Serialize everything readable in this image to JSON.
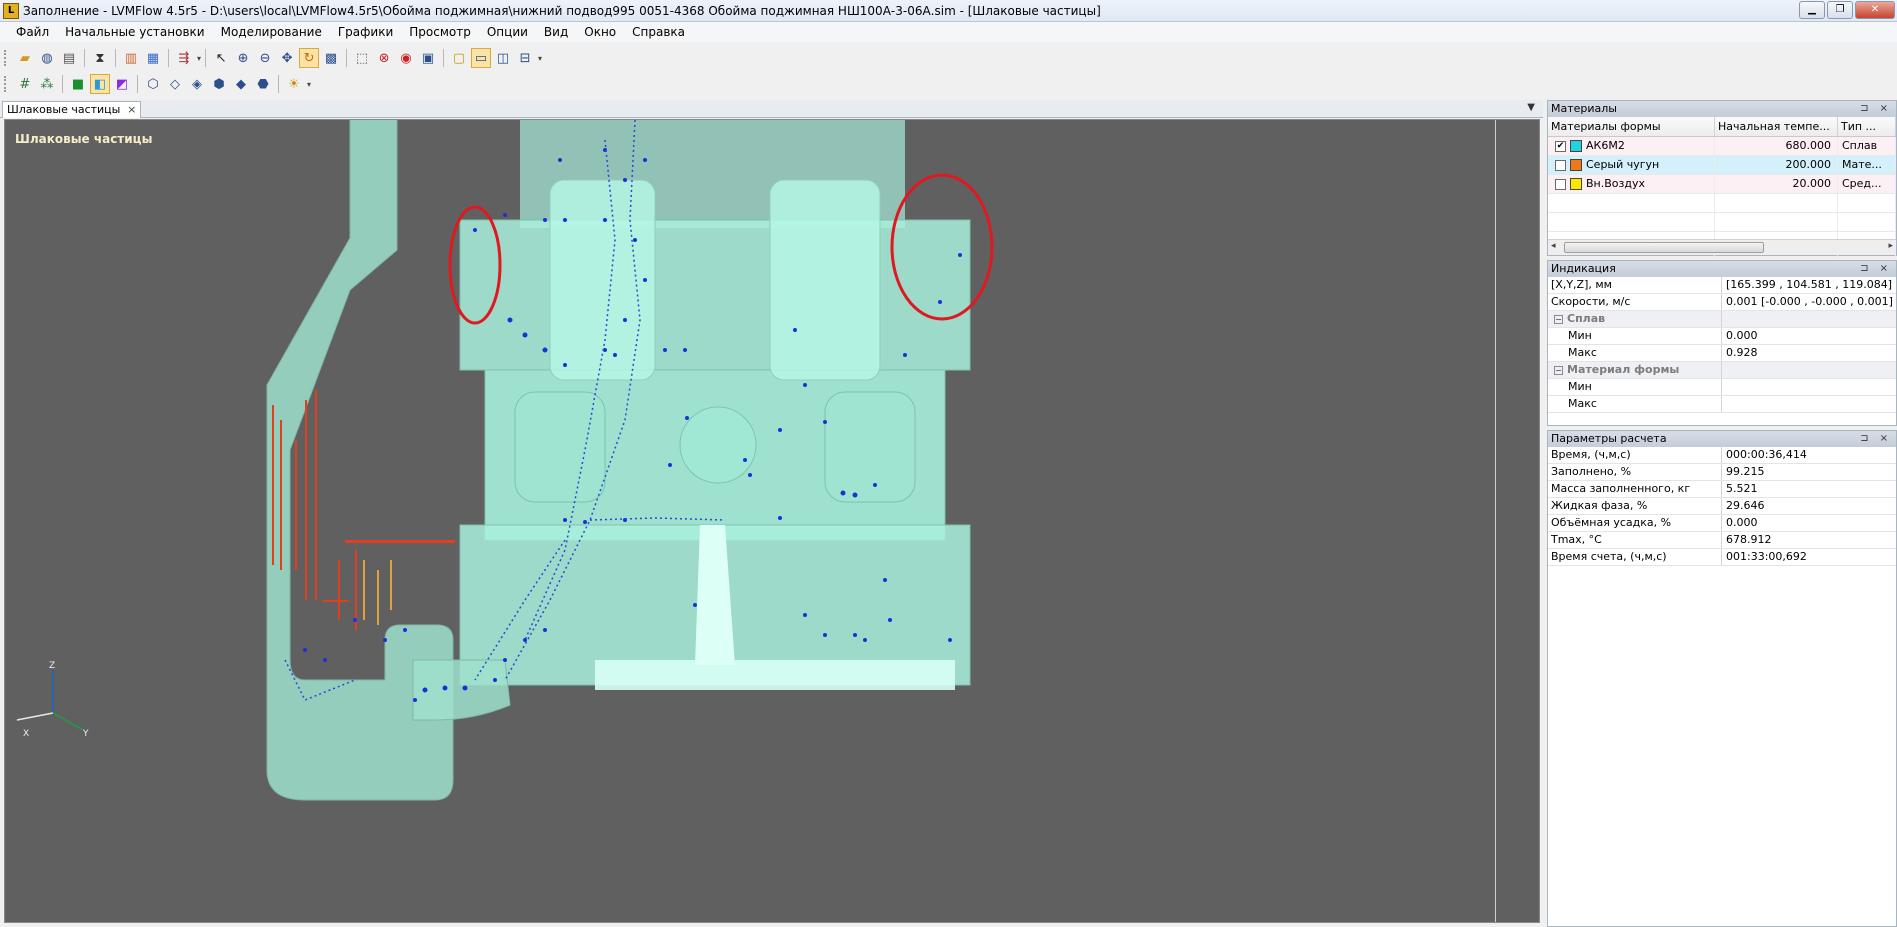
{
  "window": {
    "app_icon": "lvmflow-app-icon",
    "title": "Заполнение - LVMFlow 4.5r5 - D:\\users\\local\\LVMFlow4.5r5\\Обойма поджимная\\нижний подвод995 0051-4368 Обойма поджимная НШ100А-3-06А.sim - [Шлаковые частицы]"
  },
  "menu": {
    "items": [
      "Файл",
      "Начальные установки",
      "Моделирование",
      "Графики",
      "Просмотр",
      "Опции",
      "Вид",
      "Окно",
      "Справка"
    ]
  },
  "toolbar1": {
    "icons": [
      "open-folder-icon",
      "globe-icon",
      "print-icon",
      "hourglass-icon",
      "bar-chart-icon",
      "column-chart-icon",
      "export-icon",
      "pointer-icon",
      "zoom-in-icon",
      "zoom-out-icon",
      "pan-icon",
      "rotate-icon",
      "grid-icon",
      "select-region-icon",
      "clear-selection-icon",
      "eye-icon",
      "window-icon",
      "new-page-icon",
      "single-view-icon",
      "split-vertical-icon",
      "split-horizontal-icon"
    ],
    "active": [
      "rotate-icon",
      "single-view-icon"
    ]
  },
  "toolbar2": {
    "icons": [
      "mesh-icon",
      "points-icon",
      "solid-color-icon",
      "mold-color-icon",
      "particles-color-icon",
      "cube-front-icon",
      "cube-left-icon",
      "cube-right-icon",
      "cube-top-icon",
      "cube-bottom-icon",
      "cube-iso-icon",
      "light-icon"
    ],
    "active": [
      "mold-color-icon"
    ]
  },
  "document_tab": {
    "label": "Шлаковые частицы"
  },
  "viewport": {
    "title": "Шлаковые частицы",
    "axes": {
      "z": "Z",
      "x": "X",
      "y": "Y"
    },
    "colors": {
      "background": "#606060",
      "casting": "#9fe8d6",
      "particles": "#1030d0",
      "hot_particles": "#e04020"
    }
  },
  "materials_panel": {
    "title": "Материалы",
    "columns": [
      "Материалы формы",
      "Начальная темпе...",
      "Тип ..."
    ],
    "rows": [
      {
        "checked": true,
        "color": "#1fd3e0",
        "name": "АК6М2",
        "temp": "680.000",
        "type": "Сплав",
        "bg": "#fdf0f4"
      },
      {
        "checked": false,
        "color": "#f07818",
        "name": "Серый чугун",
        "temp": "200.000",
        "type": "Мате...",
        "bg": "#d4f1fb"
      },
      {
        "checked": false,
        "color": "#ffe800",
        "name": "Вн.Воздух",
        "temp": "20.000",
        "type": "Сред...",
        "bg": "#fdf0f4"
      }
    ]
  },
  "indication_panel": {
    "title": "Индикация",
    "rows": [
      {
        "k": "[X,Y,Z], мм",
        "v": "[165.399 , 104.581 , 119.084]",
        "kind": "row"
      },
      {
        "k": "Скорости, м/с",
        "v": "0.001  [-0.000 , -0.000 , 0.001]",
        "kind": "row"
      },
      {
        "k": "Сплав",
        "v": "",
        "kind": "group"
      },
      {
        "k": "Мин",
        "v": "0.000",
        "kind": "indent"
      },
      {
        "k": "Макс",
        "v": "0.928",
        "kind": "indent"
      },
      {
        "k": "Материал формы",
        "v": "",
        "kind": "group"
      },
      {
        "k": "Мин",
        "v": "",
        "kind": "indent"
      },
      {
        "k": "Макс",
        "v": "",
        "kind": "indent"
      }
    ]
  },
  "calc_panel": {
    "title": "Параметры расчета",
    "rows": [
      {
        "k": "Время, (ч,м,с)",
        "v": "000:00:36,414"
      },
      {
        "k": "Заполнено, %",
        "v": "99.215"
      },
      {
        "k": "Масса заполненного, кг",
        "v": "5.521"
      },
      {
        "k": "Жидкая фаза, %",
        "v": "29.646"
      },
      {
        "k": "Объёмная усадка, %",
        "v": "0.000"
      },
      {
        "k": "Tmax, °C",
        "v": "678.912"
      },
      {
        "k": "Время счета, (ч,м,с)",
        "v": "001:33:00,692"
      }
    ]
  }
}
